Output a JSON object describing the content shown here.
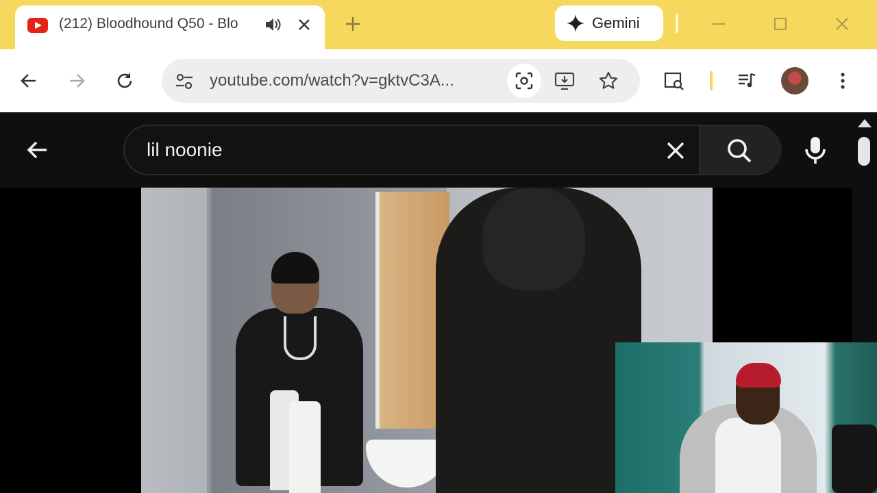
{
  "browser": {
    "tab": {
      "favicon": "youtube-icon",
      "title": "(212) Bloodhound Q50 - Blo",
      "audio_icon": "speaker-icon"
    },
    "gemini_label": "Gemini",
    "url": "youtube.com/watch?v=gktvC3A...",
    "accent_color": "#f6d85c"
  },
  "youtube": {
    "search_query": "lil noonie"
  },
  "video": {
    "description": "music video frame in a bathroom mirror"
  }
}
